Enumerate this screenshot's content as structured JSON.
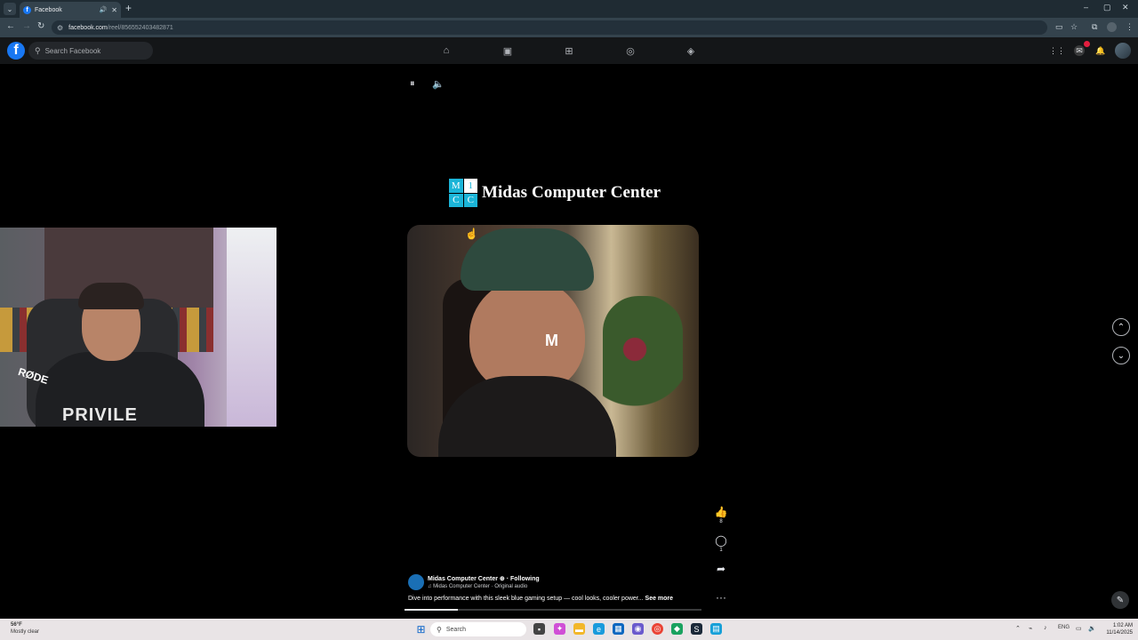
{
  "browser": {
    "tab_title": "Facebook",
    "tab_favicon": "f",
    "url_host": "facebook.com",
    "url_path": "/reel/856552403482871"
  },
  "facebook": {
    "logo": "f",
    "search_placeholder": "Search Facebook",
    "nav_tabs": [
      "home",
      "video",
      "marketplace",
      "groups",
      "gaming"
    ]
  },
  "reel": {
    "brand_logo_letters": [
      "M",
      "1",
      "C",
      "C"
    ],
    "brand_name": "Midas Computer Center",
    "video_watermark": "M",
    "likes": "8",
    "comments": "1",
    "author": "Midas Computer Center",
    "following_label": "Following",
    "audio": "Midas Computer Center · Original audio",
    "caption": "Dive into performance with this sleek blue gaming setup — cool looks, cooler power...",
    "see_more": "See more",
    "progress": 0.18
  },
  "webcam": {
    "mic_label": "RØDE",
    "shirt_text": "PRIVILE"
  },
  "taskbar": {
    "weather_temp": "56°F",
    "weather_desc": "Mostly clear",
    "search_placeholder": "Search",
    "language": "ENG",
    "time": "1:02 AM",
    "date": "11/14/2025"
  },
  "colors": {
    "facebook_blue": "#1877f2",
    "brand_cyan": "#1bb5d8",
    "notification_red": "#e41e3f"
  }
}
